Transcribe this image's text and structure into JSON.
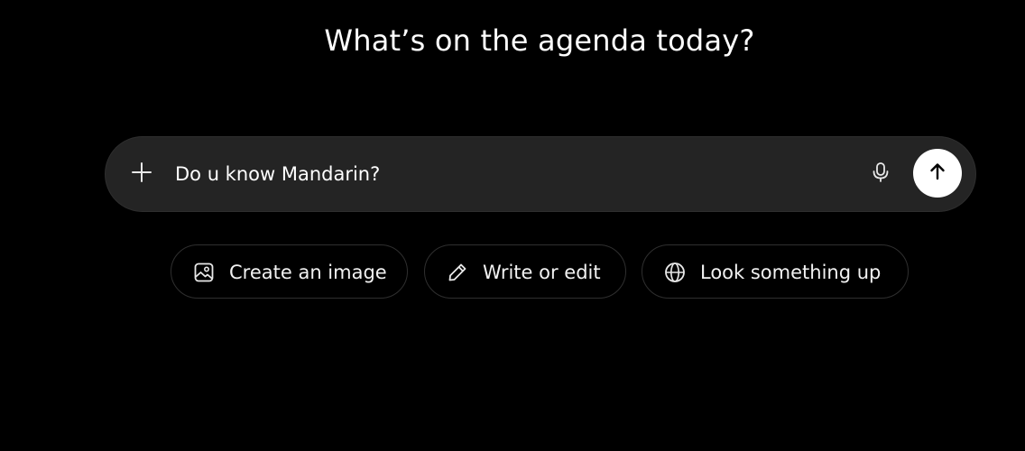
{
  "heading": "What’s on the agenda today?",
  "composer": {
    "input_value": "Do u know Mandarin?",
    "plus_icon": "plus-icon",
    "mic_icon": "microphone-icon",
    "send_icon": "arrow-up-icon"
  },
  "suggestions": [
    {
      "label": "Create an image",
      "icon": "image-icon"
    },
    {
      "label": "Write or edit",
      "icon": "pencil-icon"
    },
    {
      "label": "Look something up",
      "icon": "globe-icon"
    }
  ],
  "colors": {
    "background": "#000000",
    "composer_bg": "#242424",
    "send_button_bg": "#ffffff",
    "text": "#ffffff"
  }
}
